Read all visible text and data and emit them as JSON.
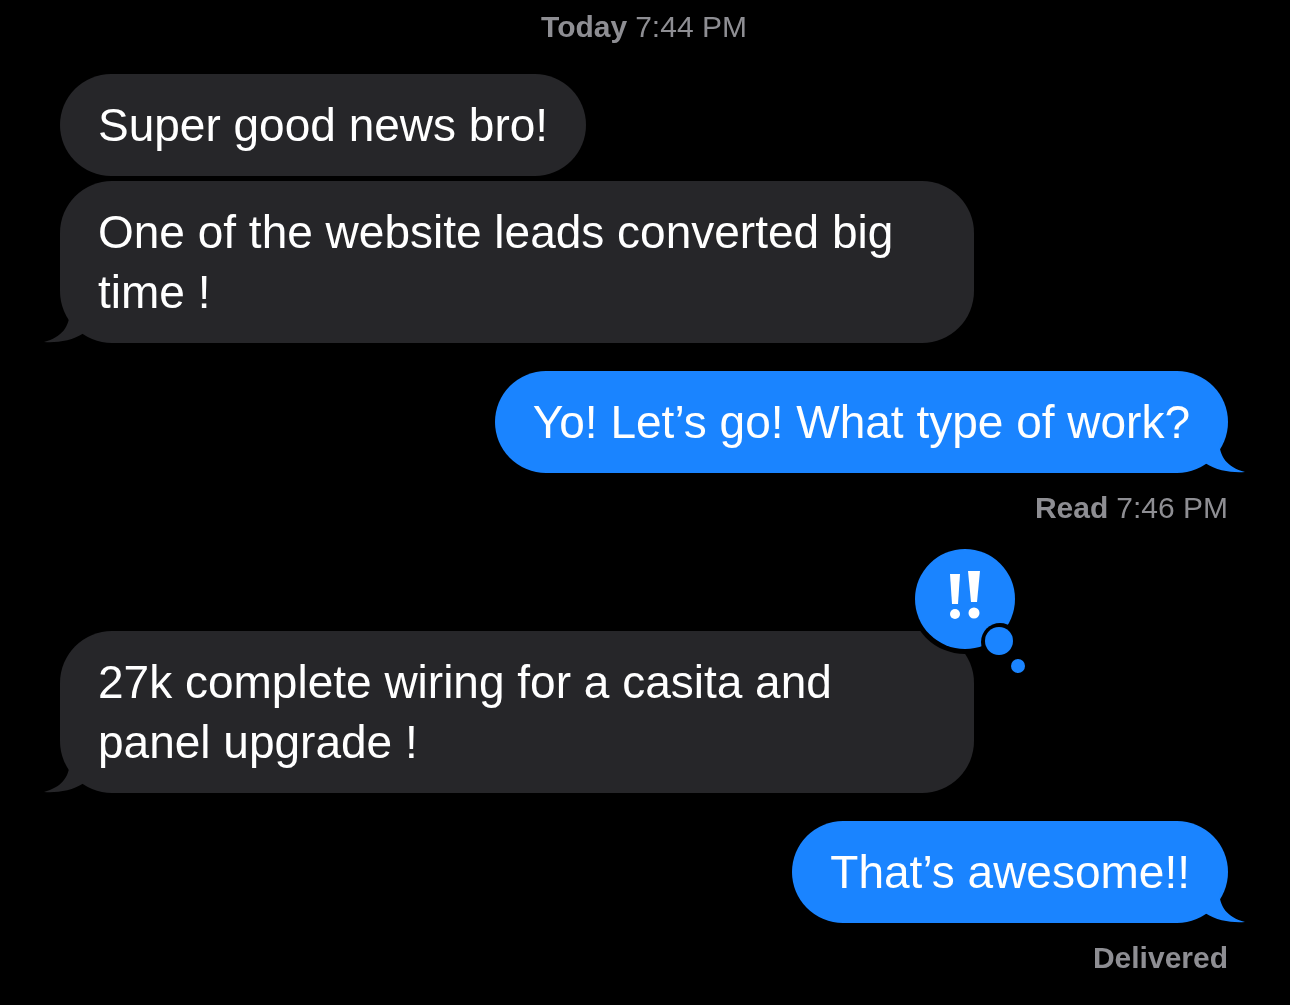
{
  "items": [
    {
      "kind": "timestamp",
      "label": "Today",
      "time": "7:44 PM"
    },
    {
      "kind": "incoming",
      "text": "Super good news bro!",
      "tail": false,
      "emphasized": false
    },
    {
      "kind": "incoming",
      "text": "One of the website leads converted big time !",
      "tail": true,
      "emphasized": false
    },
    {
      "kind": "outgoing",
      "text": "Yo! Let’s go! What type of work?",
      "tail": true,
      "emphasized": false
    },
    {
      "kind": "receipt",
      "label": "Read",
      "time": "7:46 PM"
    },
    {
      "kind": "incoming",
      "text": "27k complete wiring for a casita and panel upgrade !",
      "tail": true,
      "emphasized": true
    },
    {
      "kind": "outgoing",
      "text": "That’s awesome!!",
      "tail": true,
      "emphasized": false
    },
    {
      "kind": "receipt",
      "label": "Delivered"
    }
  ]
}
